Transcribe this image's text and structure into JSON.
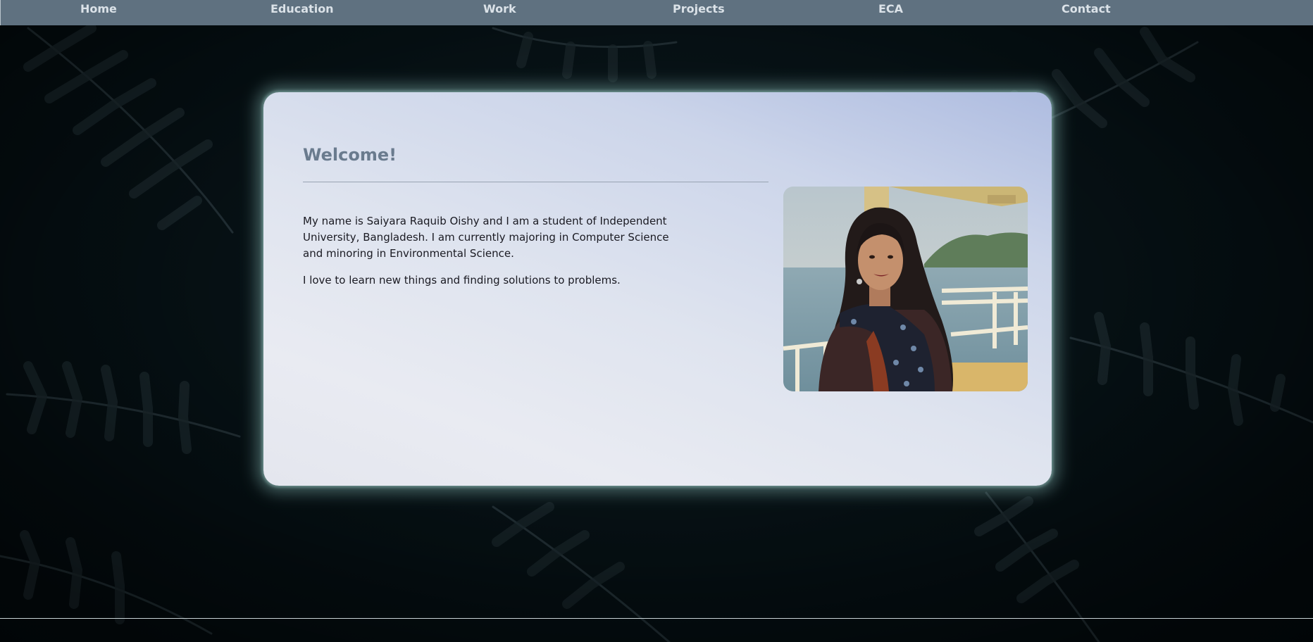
{
  "nav": {
    "items": [
      {
        "label": "Home"
      },
      {
        "label": "Education"
      },
      {
        "label": "Work"
      },
      {
        "label": "Projects"
      },
      {
        "label": "ECA"
      },
      {
        "label": "Contact"
      }
    ]
  },
  "main": {
    "title": "Welcome!",
    "paragraphs": [
      "My name is Saiyara Raquib Oishy and I am a student of Independent University, Bangladesh. I am currently majoring in Computer Science and minoring in Environmental Science.",
      "I love to learn new things and finding solutions to problems."
    ]
  },
  "colors": {
    "nav_background": "#5f7180",
    "nav_text": "#dbe2e8",
    "page_background": "#08161b",
    "card_glow": "#96cdc8",
    "title_color": "#6a7b8e",
    "body_text": "#1a1a22"
  }
}
